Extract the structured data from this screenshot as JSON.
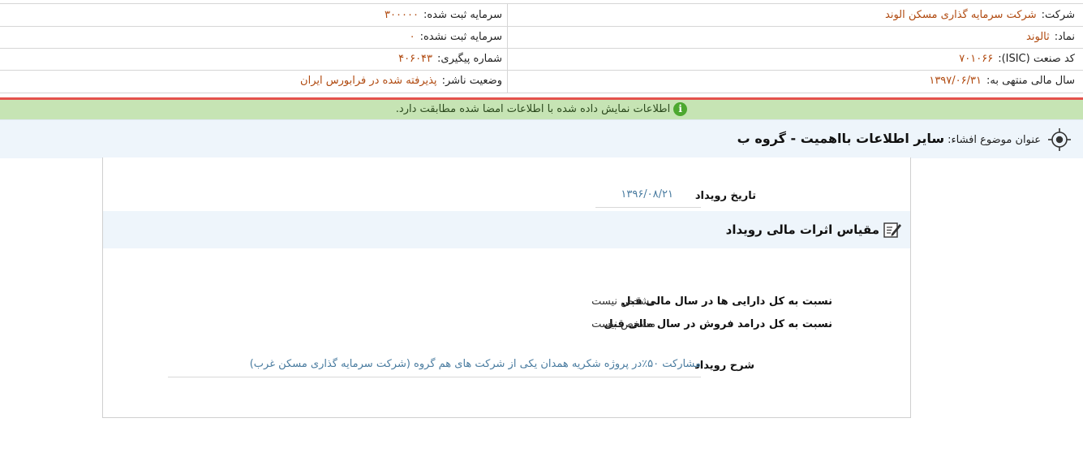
{
  "header": {
    "rows": [
      {
        "right_label": "شرکت:",
        "right_value": "شرکت سرمایه گذاری مسکن الوند",
        "left_label": "سرمایه ثبت شده:",
        "left_value": "۳۰۰۰۰۰"
      },
      {
        "right_label": "نماد:",
        "right_value": "ثالوند",
        "left_label": "سرمایه ثبت نشده:",
        "left_value": "۰"
      },
      {
        "right_label": "کد صنعت (ISIC):",
        "right_value": "۷۰۱۰۶۶",
        "left_label": "شماره پیگیری:",
        "left_value": "۴۰۶۰۴۳"
      },
      {
        "right_label": "سال مالی منتهی به:",
        "right_value": "۱۳۹۷/۰۶/۳۱",
        "left_label": "وضعیت ناشر:",
        "left_value": "پذیرفته شده در فرابورس ایران"
      }
    ]
  },
  "notice": {
    "text": "اطلاعات نمایش داده شده با اطلاعات امضا شده مطابقت دارد.",
    "icon": "info-icon"
  },
  "subject": {
    "label": "عنوان موضوع افشاء:",
    "value": "سایر اطلاعات بااهمیت - گروه ب",
    "icon": "target-icon"
  },
  "event": {
    "date_label": "تاریخ رویداد",
    "date_value": "۱۳۹۶/۰۸/۲۱"
  },
  "section": {
    "title": "مقیاس اثرات مالی رویداد",
    "icon": "edit-icon"
  },
  "measures": [
    {
      "label": "نسبت به کل دارایی ها در سال مالی قبل",
      "value": "مشخص نیست"
    },
    {
      "label": "نسبت به کل درامد فروش در سال مالی قبل",
      "value": "مشخص نیست"
    }
  ],
  "description": {
    "label": "شرح رویداد",
    "value": "مشارکت ۵۰٪در پروژه شکریه همدان یکی از شرکت های هم گروه (شرکت سرمایه گذاری مسکن غرب)"
  },
  "colors": {
    "accent_value": "#b04a10",
    "notice_bg": "#c6e4b4",
    "link_value": "#4a7ca0",
    "divider_red": "#e4524c"
  }
}
